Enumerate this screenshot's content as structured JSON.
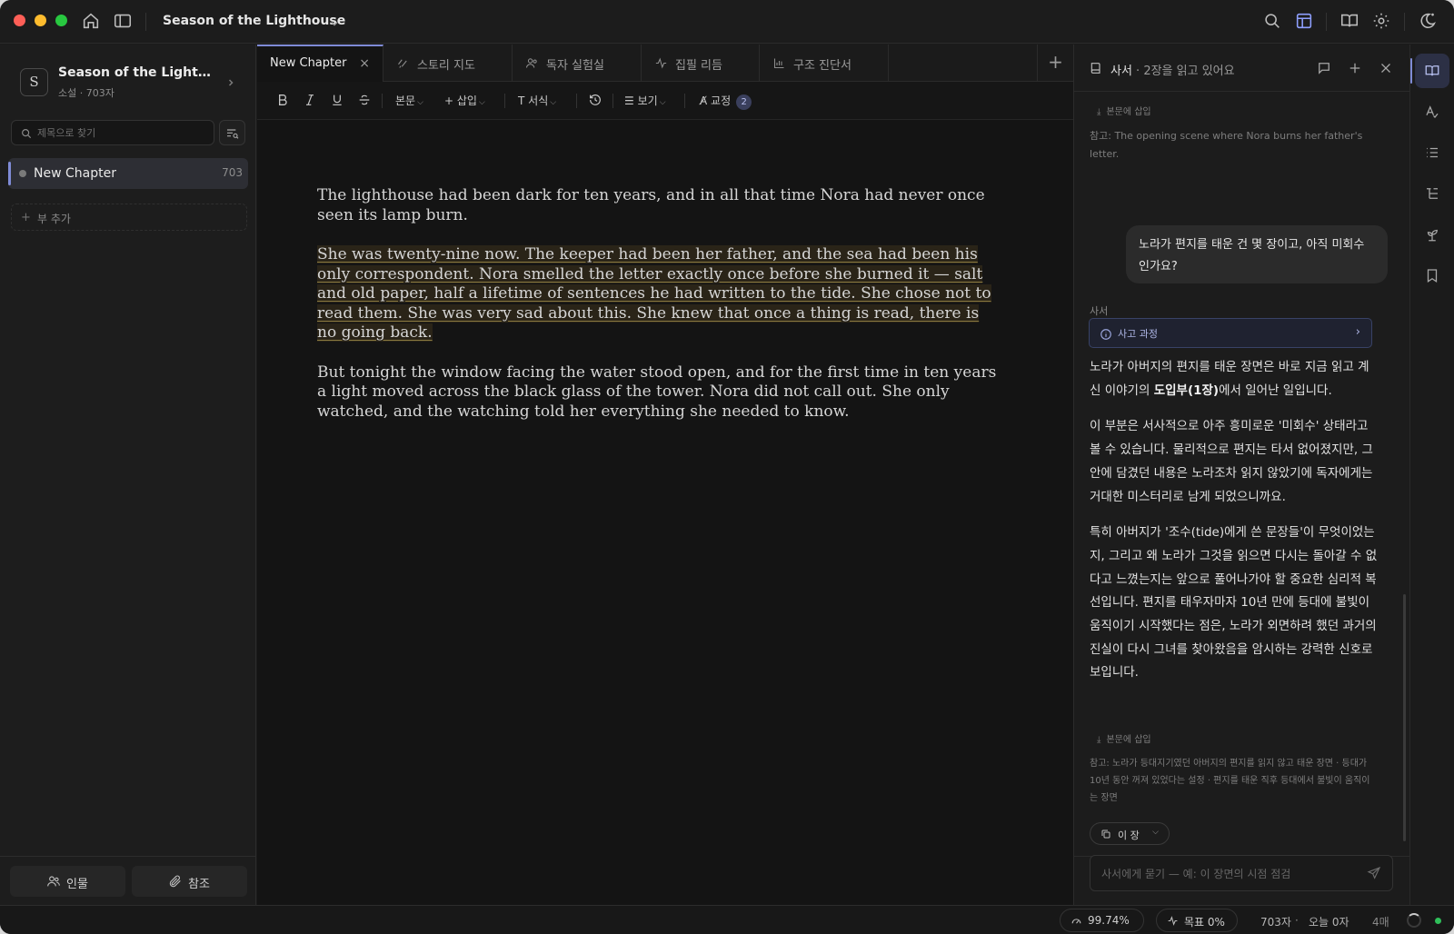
{
  "app": {
    "title": "Season of the Lighthouse"
  },
  "sidebar": {
    "project_initial": "S",
    "project_name": "Season of the Lighthou...",
    "project_meta": "소설 · 703자",
    "search_placeholder": "제목으로 찾기",
    "chapters": [
      {
        "label": "New Chapter",
        "count": "703"
      }
    ],
    "add_part_label": "부 추가",
    "people_button": "인물",
    "reference_button": "참조"
  },
  "tabs": [
    {
      "label": "New Chapter",
      "icon": "none",
      "active": true
    },
    {
      "label": "스토리 지도",
      "icon": "story-map-icon"
    },
    {
      "label": "독자 실험실",
      "icon": "readers-icon"
    },
    {
      "label": "집필 리듬",
      "icon": "pulse-icon"
    },
    {
      "label": "구조 진단서",
      "icon": "bar-chart-icon"
    }
  ],
  "toolbar": {
    "body_style": "본문",
    "insert": "삽입",
    "format": "서식",
    "view": "보기",
    "proofread": "교정",
    "proofread_count": "2"
  },
  "document": {
    "paragraphs": [
      "The lighthouse had been dark for ten years, and in all that time Nora had never once seen its lamp burn.",
      "She was twenty-nine now. The keeper had been her father, and the sea had been his only correspondent. Nora smelled the letter exactly once before she burned it — salt and old paper, half a lifetime of sentences he had written to the tide. She chose not to read them. She was very sad about this. She knew that once a thing is read, there is no going back.",
      "But tonight the window facing the water stood open, and for the first time in ten years a light moved across the black glass of the tower. Nora did not call out. She only watched, and the watching told her everything she needed to know."
    ],
    "highlighted_paragraph_index": 1
  },
  "assistant": {
    "title": "사서",
    "subtitle": " · 2장을 읽고 있어요",
    "insert_label": "본문에 삽입",
    "top_reference": "참고: The opening scene where Nora burns her father's letter.",
    "user_question": "노라가 편지를 태운 건 몇 장이고, 아직 미회수인가요?",
    "assistant_label": "사서",
    "thinking_label": "사고 과정",
    "answer_p1_pre": "노라가 아버지의 편지를 태운 장면은 바로 지금 읽고 계신 이야기의 ",
    "answer_p1_bold": "도입부(1장)",
    "answer_p1_post": "에서 일어난 일입니다.",
    "answer_p2": "이 부분은 서사적으로 아주 흥미로운 '미회수' 상태라고 볼 수 있습니다. 물리적으로 편지는 타서 없어졌지만, 그 안에 담겼던 내용은 노라조차 읽지 않았기에 독자에게는 거대한 미스터리로 남게 되었으니까요.",
    "answer_p3": "특히 아버지가 '조수(tide)에게 쓴 문장들'이 무엇이었는지, 그리고 왜 노라가 그것을 읽으면 다시는 돌아갈 수 없다고 느꼈는지는 앞으로 풀어나가야 할 중요한 심리적 복선입니다. 편지를 태우자마자 10년 만에 등대에 불빛이 움직이기 시작했다는 점은, 노라가 외면하려 했던 과거의 진실이 다시 그녀를 찾아왔음을 암시하는 강력한 신호로 보입니다.",
    "bottom_reference": "참고: 노라가 등대지기였던 아버지의 편지를 읽지 않고 태운 장면 · 등대가 10년 동안 꺼져 있었다는 설정 · 편지를 태운 직후 등대에서 불빛이 움직이는 장면",
    "scope_label": "이 장",
    "input_placeholder": "사서에게 묻기 — 예: 이 장면의 시점 점검"
  },
  "statusbar": {
    "readability": "99.74%",
    "goal": "목표 0%",
    "char_count": "703자",
    "today": "오늘 0자",
    "pages": "4매"
  },
  "colors": {
    "accent": "#7f8bd6",
    "highlight_bg": "#2a2418",
    "status_ok": "#2fbf5a"
  }
}
